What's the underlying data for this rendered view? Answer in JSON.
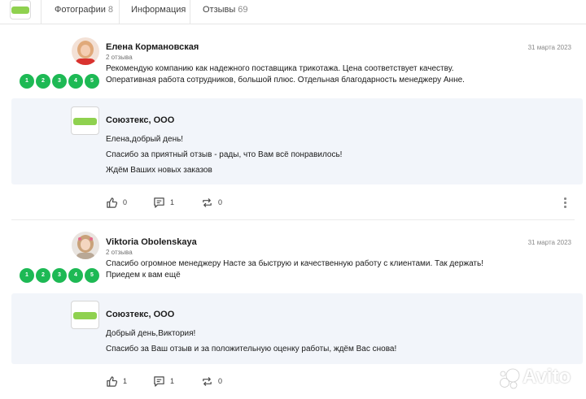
{
  "tabs": [
    {
      "label": "Фотографии",
      "count": "8"
    },
    {
      "label": "Информация",
      "count": ""
    },
    {
      "label": "Отзывы",
      "count": "69"
    }
  ],
  "reviews": [
    {
      "author": "Елена Кормановская",
      "reviews_count": "2 отзыва",
      "date": "31 марта 2023",
      "rating_badges": [
        "1",
        "2",
        "3",
        "4",
        "5"
      ],
      "text_lines": [
        "Рекомендую компанию как надежного поставщика трикотажа. Цена соответствует качеству.",
        "Оперативная работа сотрудников, большой плюс. Отдельная благодарность менеджеру Анне."
      ],
      "reply": {
        "name": "Союзтекс, ООО",
        "lines": [
          "Елена,добрый день!",
          "Спасибо за приятный отзыв - рады, что Вам всё понравилось!",
          "Ждём Ваших новых заказов"
        ]
      },
      "likes": "0",
      "comments": "1",
      "reposts": "0"
    },
    {
      "author": "Viktoria Obolenskaya",
      "reviews_count": "2 отзыва",
      "date": "31 марта 2023",
      "rating_badges": [
        "1",
        "2",
        "3",
        "4",
        "5"
      ],
      "text_lines": [
        "Спасибо огромное менеджеру Насте за быструю и качественную работу с клиентами. Так держать!",
        "Приедем к вам ещё"
      ],
      "reply": {
        "name": "Союзтекс, ООО",
        "lines": [
          "Добрый день,Виктория!",
          "Спасибо за Ваш отзыв и за положительную оценку работы, ждём Вас снова!"
        ]
      },
      "likes": "1",
      "comments": "1",
      "reposts": "0"
    }
  ],
  "watermark": "Avito",
  "colors": {
    "accent_green": "#1db954",
    "logo_green": "#8fd14f",
    "reply_bg": "#f2f5fa"
  }
}
